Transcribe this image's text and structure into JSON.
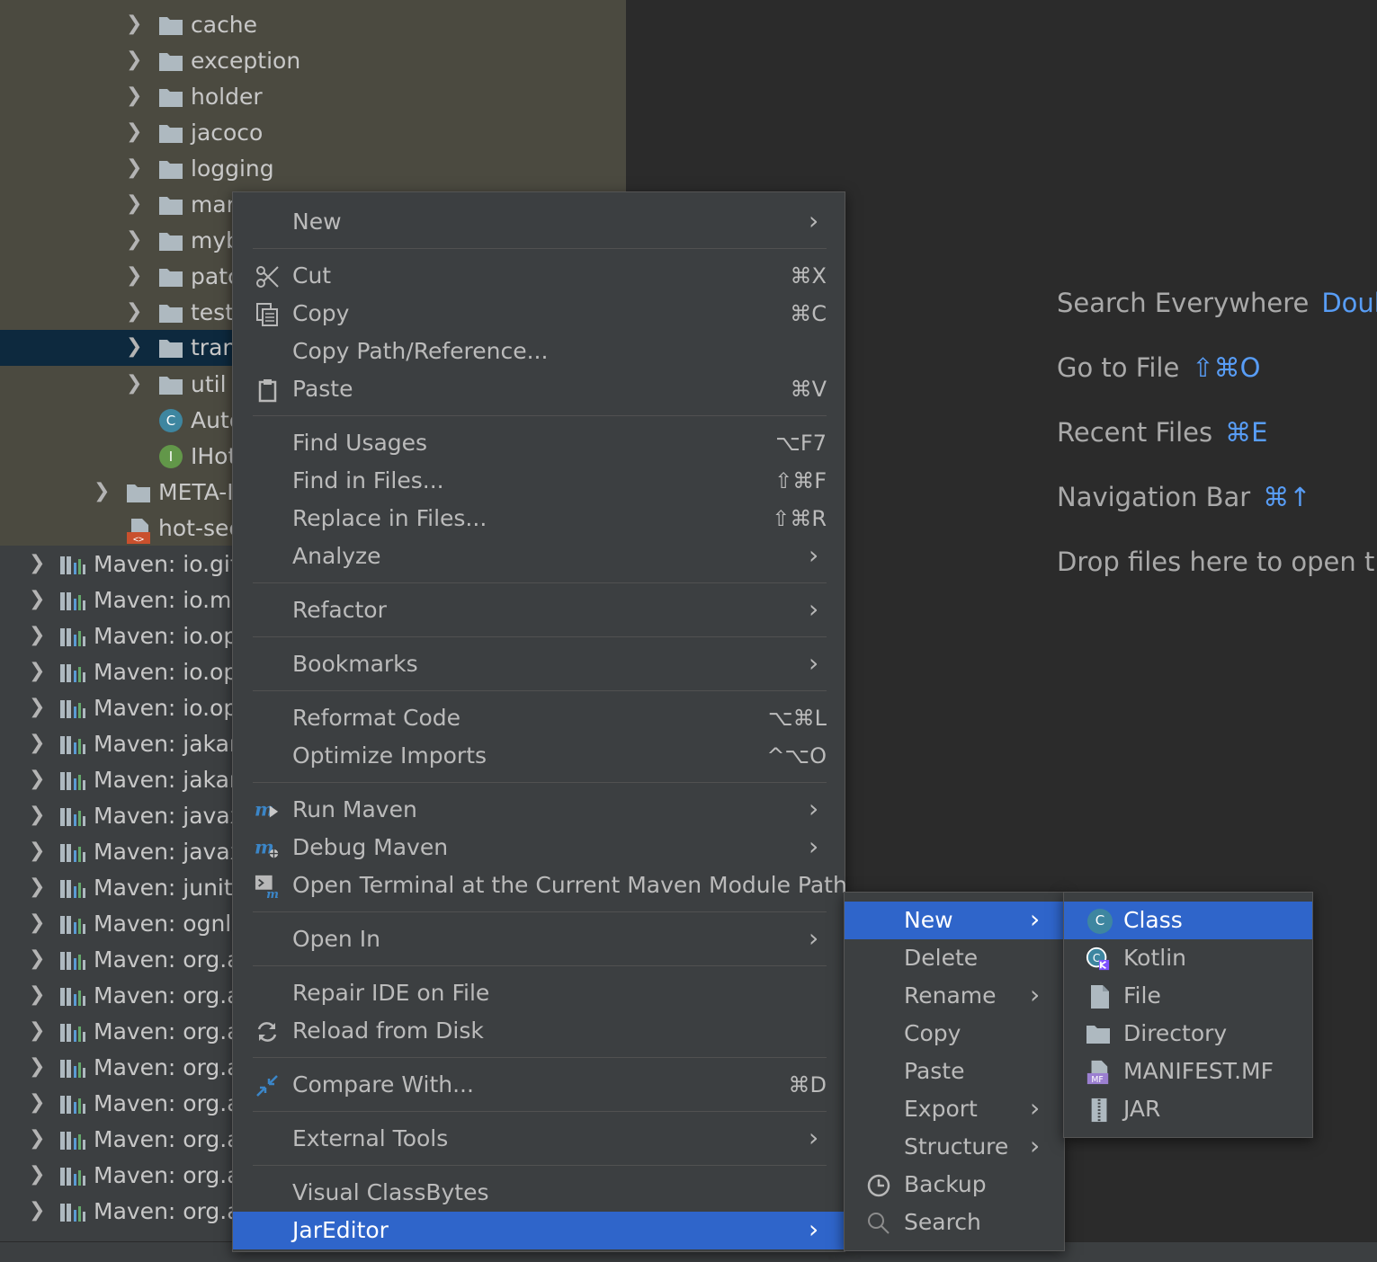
{
  "tree": {
    "items": [
      {
        "label": "cache",
        "type": "folder"
      },
      {
        "label": "exception",
        "type": "folder"
      },
      {
        "label": "holder",
        "type": "folder"
      },
      {
        "label": "jacoco",
        "type": "folder"
      },
      {
        "label": "logging",
        "type": "folder"
      },
      {
        "label": "mar",
        "type": "folder"
      },
      {
        "label": "myb",
        "type": "folder"
      },
      {
        "label": "patc",
        "type": "folder"
      },
      {
        "label": "test",
        "type": "folder"
      },
      {
        "label": "tran",
        "type": "folder",
        "selected": true
      },
      {
        "label": "util",
        "type": "folder"
      },
      {
        "label": "Auto",
        "type": "class",
        "icon_letter": "C"
      },
      {
        "label": "IHot",
        "type": "interface",
        "icon_letter": "I"
      },
      {
        "label": "META-I",
        "type": "folder"
      },
      {
        "label": "hot-sec",
        "type": "xml"
      }
    ],
    "libraries": [
      "Maven: io.gith",
      "Maven: io.mir",
      "Maven: io.ope",
      "Maven: io.ope",
      "Maven: io.ope",
      "Maven: jakart",
      "Maven: jakart",
      "Maven: javax.",
      "Maven: javax.",
      "Maven: junit:j",
      "Maven: ognl:c",
      "Maven: org.ap",
      "Maven: org.ap",
      "Maven: org.ap",
      "Maven: org.ap",
      "Maven: org.ap",
      "Maven: org.ap",
      "Maven: org.ap",
      "Maven: org.ap"
    ]
  },
  "editor_hints": [
    {
      "label": "Search Everywhere",
      "shortcut": "Doub"
    },
    {
      "label": "Go to File",
      "shortcut": "⇧⌘O"
    },
    {
      "label": "Recent Files",
      "shortcut": "⌘E"
    },
    {
      "label": "Navigation Bar",
      "shortcut": "⌘↑"
    },
    {
      "label": "Drop files here to open th",
      "shortcut": ""
    }
  ],
  "context_menu": {
    "items": [
      {
        "label": "New",
        "shortcut": "",
        "submenu": true
      },
      {
        "label": "Cut",
        "shortcut": "⌘X",
        "icon": "scissors-icon"
      },
      {
        "label": "Copy",
        "shortcut": "⌘C",
        "icon": "copy-icon"
      },
      {
        "label": "Copy Path/Reference...",
        "shortcut": ""
      },
      {
        "label": "Paste",
        "shortcut": "⌘V",
        "icon": "clipboard-icon"
      },
      {
        "label": "Find Usages",
        "shortcut": "⌥F7"
      },
      {
        "label": "Find in Files...",
        "shortcut": "⇧⌘F"
      },
      {
        "label": "Replace in Files...",
        "shortcut": "⇧⌘R"
      },
      {
        "label": "Analyze",
        "shortcut": "",
        "submenu": true
      },
      {
        "label": "Refactor",
        "shortcut": "",
        "submenu": true
      },
      {
        "label": "Bookmarks",
        "shortcut": "",
        "submenu": true
      },
      {
        "label": "Reformat Code",
        "shortcut": "⌥⌘L"
      },
      {
        "label": "Optimize Imports",
        "shortcut": "^⌥O"
      },
      {
        "label": "Run Maven",
        "shortcut": "",
        "submenu": true,
        "icon": "maven-run-icon"
      },
      {
        "label": "Debug Maven",
        "shortcut": "",
        "submenu": true,
        "icon": "maven-debug-icon"
      },
      {
        "label": "Open Terminal at the Current Maven Module Path",
        "shortcut": "",
        "icon": "terminal-icon"
      },
      {
        "label": "Open In",
        "shortcut": "",
        "submenu": true
      },
      {
        "label": "Repair IDE on File",
        "shortcut": ""
      },
      {
        "label": "Reload from Disk",
        "shortcut": "",
        "icon": "reload-icon"
      },
      {
        "label": "Compare With...",
        "shortcut": "⌘D",
        "icon": "compare-icon"
      },
      {
        "label": "External Tools",
        "shortcut": "",
        "submenu": true
      },
      {
        "label": "Visual ClassBytes",
        "shortcut": ""
      },
      {
        "label": "JarEditor",
        "shortcut": "",
        "submenu": true,
        "highlighted": true
      }
    ]
  },
  "jareditor_menu": {
    "items": [
      {
        "label": "New",
        "submenu": true,
        "highlighted": true
      },
      {
        "label": "Delete"
      },
      {
        "label": "Rename",
        "submenu": true
      },
      {
        "label": "Copy"
      },
      {
        "label": "Paste"
      },
      {
        "label": "Export",
        "submenu": true
      },
      {
        "label": "Structure",
        "submenu": true
      },
      {
        "label": "Backup",
        "icon": "clock-icon"
      },
      {
        "label": "Search",
        "icon": "search-icon"
      }
    ]
  },
  "new_menu": {
    "items": [
      {
        "label": "Class",
        "icon": "class-icon",
        "highlighted": true
      },
      {
        "label": "Kotlin",
        "icon": "kotlin-icon"
      },
      {
        "label": "File",
        "icon": "file-icon"
      },
      {
        "label": "Directory",
        "icon": "folder-icon"
      },
      {
        "label": "MANIFEST.MF",
        "icon": "manifest-icon"
      },
      {
        "label": "JAR",
        "icon": "jar-icon"
      }
    ]
  },
  "colors": {
    "accent": "#2f65ca",
    "shortcut_blue": "#589df6",
    "selection": "#0d293e",
    "menu_bg": "#3c3f41"
  }
}
